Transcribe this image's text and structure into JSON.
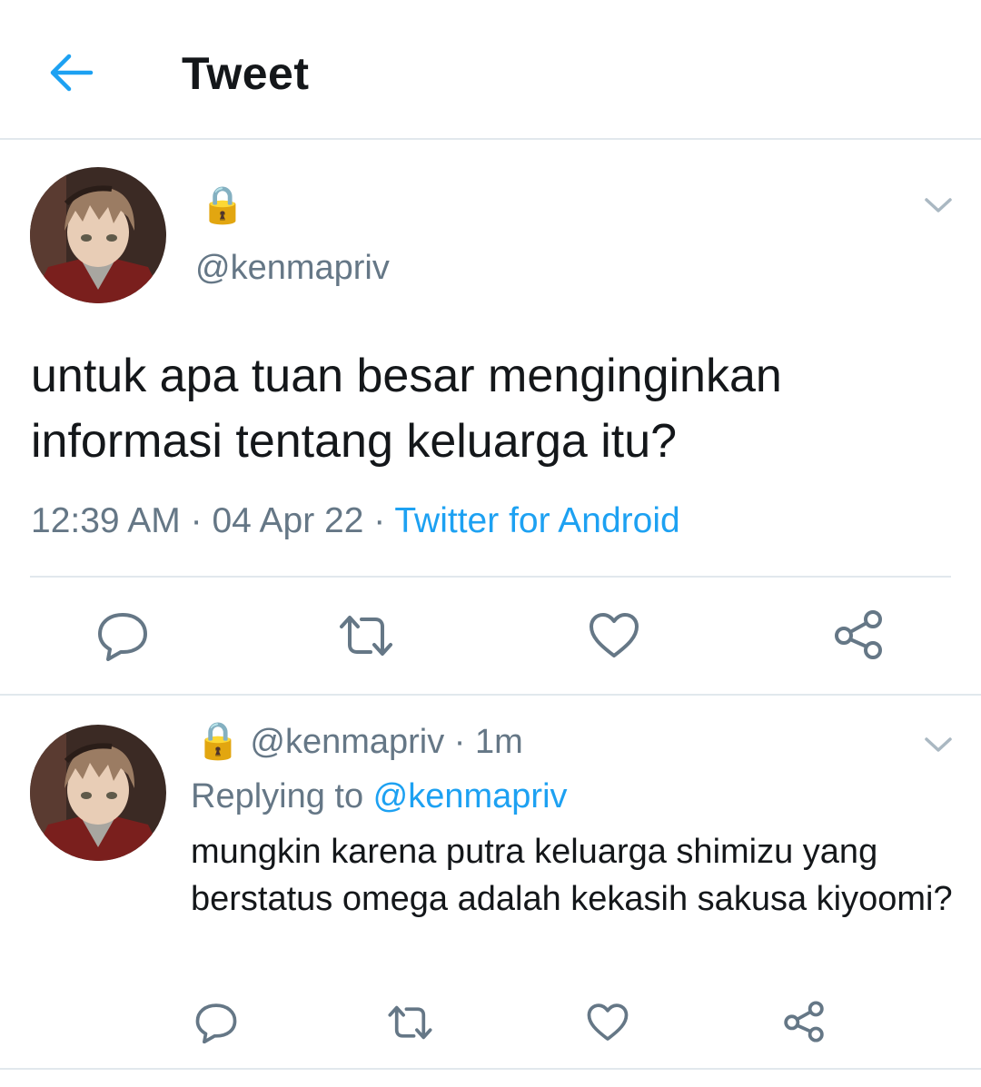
{
  "header": {
    "title": "Tweet"
  },
  "main_tweet": {
    "display_name_icon": "🔒",
    "handle": "@kenmapriv",
    "text": "untuk apa tuan besar menginginkan informasi tentang keluarga itu?",
    "time": "12:39 AM",
    "date": "04 Apr 22",
    "separator": " · ",
    "source": "Twitter for Android"
  },
  "reply_tweet": {
    "display_name_icon": "🔒",
    "handle": "@kenmapriv",
    "time_sep": " · ",
    "time": "1m",
    "replying_label": "Replying to ",
    "replying_to": "@kenmapriv",
    "text": "mungkin karena putra keluarga shimizu yang berstatus omega adalah kekasih sakusa kiyoomi?"
  },
  "icons": {
    "back": "arrow-left-icon",
    "caret": "chevron-down-icon",
    "reply": "comment-bubble-icon",
    "retweet": "retweet-icon",
    "like": "heart-icon",
    "share": "share-icon"
  },
  "colors": {
    "accent": "#1da1f2",
    "secondary_text": "#657786",
    "divider": "#e1e8ed",
    "icon": "#657786"
  }
}
